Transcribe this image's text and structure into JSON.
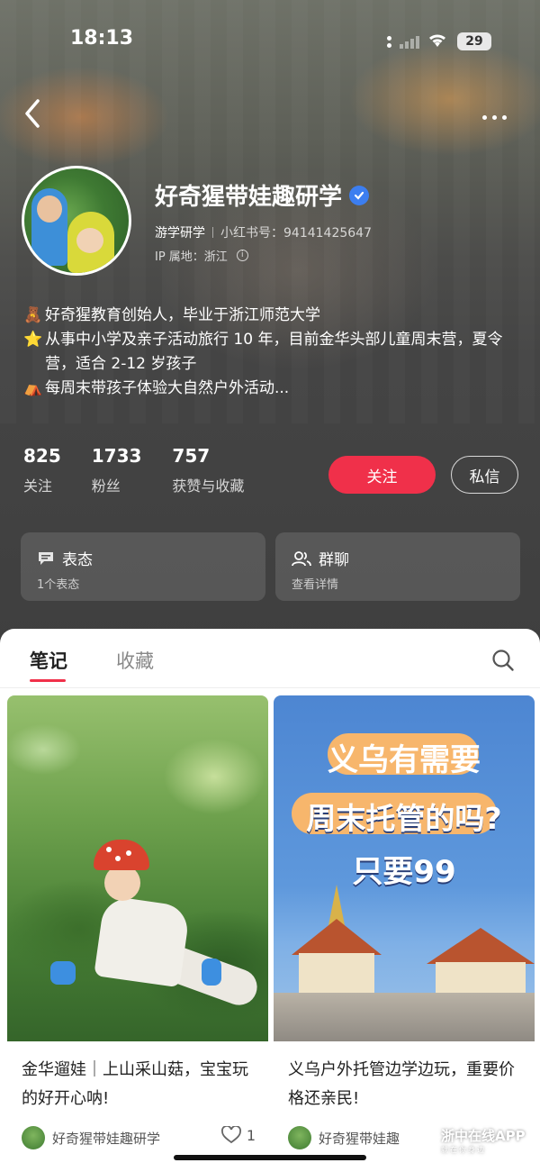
{
  "status_bar": {
    "time": "18:13",
    "battery": "29"
  },
  "profile": {
    "name": "好奇猩带娃趣研学",
    "tag": "游学研学",
    "account_id": "小红书号：94141425647",
    "ip_location": "IP 属地：浙江",
    "bio": [
      {
        "emoji": "🧸",
        "text": "好奇猩教育创始人，毕业于浙江师范大学"
      },
      {
        "emoji": "⭐",
        "text": "从事中小学及亲子活动旅行 10 年，目前金华头部儿童周末营，夏令营，适合 2-12 岁孩子"
      },
      {
        "emoji": "⛺",
        "text": "每周末带孩子体验大自然户外活动..."
      }
    ]
  },
  "stats": [
    {
      "value": "825",
      "label": "关注"
    },
    {
      "value": "1733",
      "label": "粉丝"
    },
    {
      "value": "757",
      "label": "获赞与收藏"
    }
  ],
  "actions": {
    "follow": "关注",
    "message": "私信"
  },
  "cards": [
    {
      "title": "表态",
      "sub": "1个表态",
      "icon": "chat-bubble-icon"
    },
    {
      "title": "群聊",
      "sub": "查看详情",
      "icon": "group-icon"
    }
  ],
  "tabs": [
    {
      "label": "笔记",
      "active": true
    },
    {
      "label": "收藏",
      "active": false
    }
  ],
  "notes": [
    {
      "caption": "金华遛娃｜上山采山菇，宝宝玩的好开心呐!",
      "author": "好奇猩带娃趣研学",
      "likes": "1"
    },
    {
      "caption": "义乌户外托管边学边玩，重要价格还亲民!",
      "author": "好奇猩带娃趣",
      "poster_lines": [
        "义乌有需要",
        "周末托管的吗?",
        "只要99"
      ]
    }
  ],
  "watermark": {
    "name": "浙中在线APP",
    "sub": "就在你身边"
  },
  "colors": {
    "accent": "#f0304a",
    "verified": "#3c7ef0"
  }
}
